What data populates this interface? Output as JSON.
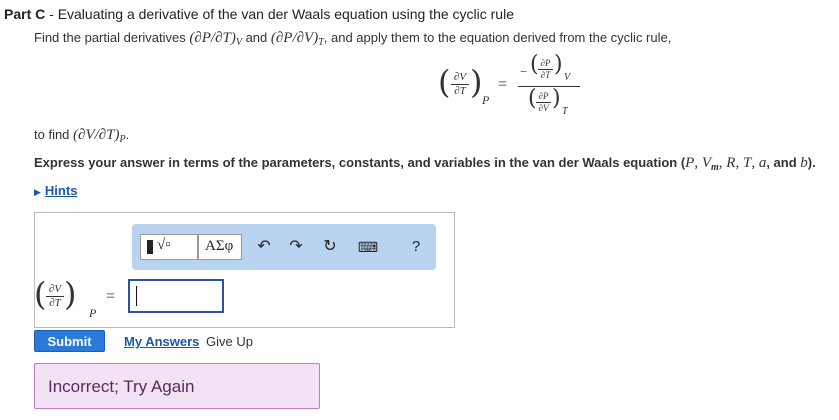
{
  "header": {
    "part_label": "Part C",
    "part_sep": " - ",
    "part_title": "Evaluating a derivative of the van der Waals equation using the cyclic rule"
  },
  "instruction": {
    "t1": "Find the partial derivatives ",
    "expr1": "(∂P/∂T)",
    "sub1": "V",
    "t2": " and ",
    "expr2": "(∂P/∂V)",
    "sub2": "T",
    "t3": ", and apply them to the equation derived from the cyclic rule,"
  },
  "display_equation": {
    "lhs_num": "∂V",
    "lhs_den": "∂T",
    "lhs_sub": "P",
    "equals": "=",
    "minus": "−",
    "rhs_top_num": "∂P",
    "rhs_top_den": "∂T",
    "rhs_top_sub": "V",
    "rhs_bot_num": "∂P",
    "rhs_bot_den": "∂V",
    "rhs_bot_sub": "T"
  },
  "find": {
    "t1": "to find ",
    "expr": "(∂V/∂T)",
    "sub": "P",
    "t2": "."
  },
  "express": {
    "t1": "Express your answer in terms of the parameters, constants, and variables in the van der Waals equation (",
    "v1": "P",
    "c1": ", ",
    "v2": "V",
    "v2sub": "m",
    "c2": ", ",
    "v3": "R",
    "c3": ", ",
    "v4": "T",
    "c4": ", ",
    "v5": "a",
    "c5": ", and ",
    "v6": "b",
    "t2": ")."
  },
  "hints": {
    "label": "Hints"
  },
  "toolbar": {
    "templates_icon": "template-square-root-icon",
    "greek_label": "ΑΣφ",
    "undo_icon": "undo-icon",
    "redo_icon": "redo-icon",
    "reset_icon": "reset-icon",
    "keyboard_icon": "keyboard-icon",
    "help_label": "?"
  },
  "answer": {
    "lhs_num": "∂V",
    "lhs_den": "∂T",
    "lhs_sub": "P",
    "equals": "=",
    "value": ""
  },
  "actions": {
    "submit": "Submit",
    "my_answers": "My Answers",
    "give_up": "Give Up"
  },
  "feedback": {
    "message": "Incorrect; Try Again"
  },
  "colors": {
    "accent_blue": "#2a7bd8",
    "toolbar_bg": "#b8d4f0",
    "link": "#1a5aa6",
    "feedback_bg": "#f3e2f3",
    "feedback_border": "#c47ac4"
  }
}
